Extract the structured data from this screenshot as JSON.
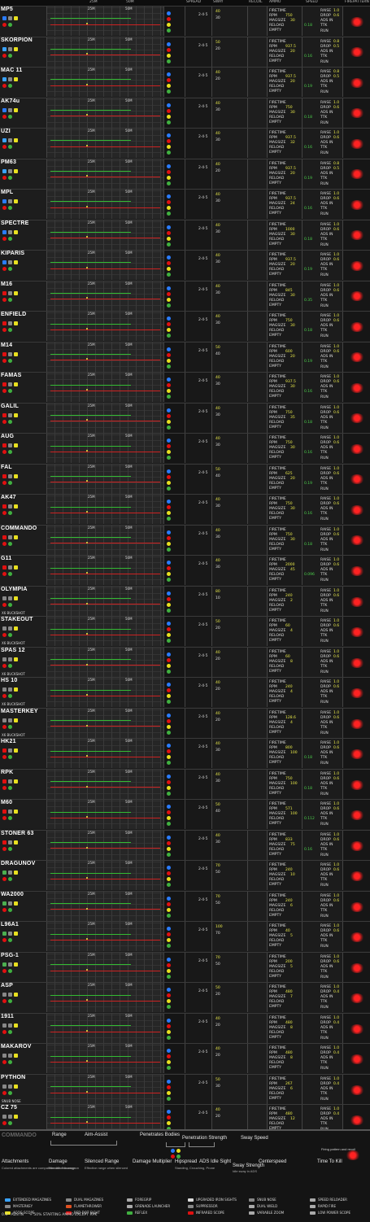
{
  "headers": {
    "damage": "DAMAGE",
    "spread": "SPREAD",
    "sway": "SWAY",
    "recoil": "RECOIL",
    "ammo": "AMMO",
    "speed": "SPEED",
    "firepattern": "FIREPATTERN",
    "r25": "25M",
    "r50": "50M",
    "r75": "75M",
    "firetime": "FIRETIME",
    "rpm": "RPM",
    "magsize": "MAGSIZE",
    "reload": "RELOAD",
    "empty": "EMPTY",
    "raise": "RAISE",
    "drop": "DROP",
    "ads_in": "ADS IN",
    "ttk": "TTK",
    "run": "RUN"
  },
  "weapons": [
    {
      "name": "MP5",
      "sub": "",
      "accent": "#2a7cff",
      "dmg1": "40",
      "dmg2": "30",
      "mag": "30",
      "rpm": "750",
      "ttk": "0.18",
      "raise": "1.0",
      "drop": "0.6"
    },
    {
      "name": "SKORPION",
      "sub": "",
      "accent": "#3aa3ff",
      "dmg1": "50",
      "dmg2": "20",
      "mag": "20",
      "rpm": "937.5",
      "ttk": "0.16",
      "raise": "0.8",
      "drop": "0.5"
    },
    {
      "name": "MAC 11",
      "sub": "",
      "accent": "#3aa3ff",
      "dmg1": "40",
      "dmg2": "20",
      "mag": "20",
      "rpm": "937.5",
      "ttk": "0.19",
      "raise": "0.8",
      "drop": "0.5"
    },
    {
      "name": "AK74u",
      "sub": "",
      "accent": "#2a7cff",
      "dmg1": "40",
      "dmg2": "30",
      "mag": "30",
      "rpm": "750",
      "ttk": "0.18",
      "raise": "1.0",
      "drop": "0.6"
    },
    {
      "name": "UZI",
      "sub": "",
      "accent": "#3aa3ff",
      "dmg1": "40",
      "dmg2": "30",
      "mag": "32",
      "rpm": "937.5",
      "ttk": "0.16",
      "raise": "1.0",
      "drop": "0.6"
    },
    {
      "name": "PM63",
      "sub": "",
      "accent": "#3aa3ff",
      "dmg1": "40",
      "dmg2": "20",
      "mag": "20",
      "rpm": "937.5",
      "ttk": "0.19",
      "raise": "0.8",
      "drop": "0.5"
    },
    {
      "name": "MPL",
      "sub": "",
      "accent": "#2a7cff",
      "dmg1": "40",
      "dmg2": "30",
      "mag": "24",
      "rpm": "937.5",
      "ttk": "0.16",
      "raise": "1.0",
      "drop": "0.6"
    },
    {
      "name": "SPECTRE",
      "sub": "",
      "accent": "#2a7cff",
      "dmg1": "40",
      "dmg2": "30",
      "mag": "30",
      "rpm": "1000",
      "ttk": "0.18",
      "raise": "1.0",
      "drop": "0.6"
    },
    {
      "name": "KIPARIS",
      "sub": "",
      "accent": "#2a7cff",
      "dmg1": "40",
      "dmg2": "30",
      "mag": "20",
      "rpm": "937.5",
      "ttk": "0.19",
      "raise": "1.0",
      "drop": "0.6"
    },
    {
      "name": "M16",
      "sub": "",
      "accent": "#e01010",
      "dmg1": "40",
      "dmg2": "30",
      "mag": "30",
      "rpm": "845",
      "ttk": "0.35",
      "raise": "1.0",
      "drop": "0.6"
    },
    {
      "name": "ENFIELD",
      "sub": "",
      "accent": "#e01010",
      "dmg1": "40",
      "dmg2": "30",
      "mag": "30",
      "rpm": "750",
      "ttk": "0.18",
      "raise": "1.0",
      "drop": "0.6"
    },
    {
      "name": "M14",
      "sub": "",
      "accent": "#e01010",
      "dmg1": "50",
      "dmg2": "40",
      "mag": "20",
      "rpm": "600",
      "ttk": "0.19",
      "raise": "1.0",
      "drop": "0.6"
    },
    {
      "name": "FAMAS",
      "sub": "",
      "accent": "#e01010",
      "dmg1": "40",
      "dmg2": "30",
      "mag": "30",
      "rpm": "937.5",
      "ttk": "0.16",
      "raise": "1.0",
      "drop": "0.6"
    },
    {
      "name": "GALIL",
      "sub": "",
      "accent": "#e01010",
      "dmg1": "40",
      "dmg2": "30",
      "mag": "35",
      "rpm": "750",
      "ttk": "0.18",
      "raise": "1.0",
      "drop": "0.6"
    },
    {
      "name": "AUG",
      "sub": "",
      "accent": "#e01010",
      "dmg1": "40",
      "dmg2": "30",
      "mag": "30",
      "rpm": "750",
      "ttk": "0.16",
      "raise": "1.0",
      "drop": "0.6"
    },
    {
      "name": "FAL",
      "sub": "",
      "accent": "#e01010",
      "dmg1": "50",
      "dmg2": "40",
      "mag": "20",
      "rpm": "625",
      "ttk": "0.19",
      "raise": "1.0",
      "drop": "0.6"
    },
    {
      "name": "AK47",
      "sub": "",
      "accent": "#e01010",
      "dmg1": "40",
      "dmg2": "30",
      "mag": "30",
      "rpm": "750",
      "ttk": "0.16",
      "raise": "1.0",
      "drop": "0.6"
    },
    {
      "name": "COMMANDO",
      "sub": "",
      "accent": "#e01010",
      "dmg1": "40",
      "dmg2": "30",
      "mag": "30",
      "rpm": "750",
      "ttk": "0.18",
      "raise": "1.0",
      "drop": "0.6"
    },
    {
      "name": "G11",
      "sub": "",
      "accent": "#e01010",
      "dmg1": "40",
      "dmg2": "30",
      "mag": "45",
      "rpm": "2000",
      "ttk": "0.096",
      "raise": "1.0",
      "drop": "0.6"
    },
    {
      "name": "OLYMPIA",
      "sub": "X6 BUCKSHOT",
      "accent": "#888888",
      "dmg1": "80",
      "dmg2": "10",
      "mag": "2",
      "rpm": "240",
      "ttk": "",
      "raise": "1.0",
      "drop": "0.6"
    },
    {
      "name": "STAKEOUT",
      "sub": "X6 BUCKSHOT",
      "accent": "#888888",
      "dmg1": "50",
      "dmg2": "20",
      "mag": "4",
      "rpm": "60",
      "ttk": "",
      "raise": "1.0",
      "drop": "0.6"
    },
    {
      "name": "SPAS 12",
      "sub": "X6 BUCKSHOT",
      "accent": "#888888",
      "dmg1": "40",
      "dmg2": "20",
      "mag": "8",
      "rpm": "60",
      "ttk": "",
      "raise": "1.0",
      "drop": "0.6"
    },
    {
      "name": "HS 10",
      "sub": "X6 BUCKSHOT",
      "accent": "#888888",
      "dmg1": "40",
      "dmg2": "20",
      "mag": "4",
      "rpm": "240",
      "ttk": "",
      "raise": "1.0",
      "drop": "0.6"
    },
    {
      "name": "MASTERKEY",
      "sub": "X6 BUCKSHOT",
      "accent": "#888888",
      "dmg1": "40",
      "dmg2": "20",
      "mag": "4",
      "rpm": "128.6",
      "ttk": "",
      "raise": "1.0",
      "drop": "0.6"
    },
    {
      "name": "HK21",
      "sub": "",
      "accent": "#e01010",
      "dmg1": "40",
      "dmg2": "30",
      "mag": "100",
      "rpm": "800",
      "ttk": "0.18",
      "raise": "1.0",
      "drop": "0.6"
    },
    {
      "name": "RPK",
      "sub": "",
      "accent": "#e01010",
      "dmg1": "40",
      "dmg2": "30",
      "mag": "100",
      "rpm": "750",
      "ttk": "0.18",
      "raise": "1.0",
      "drop": "0.6"
    },
    {
      "name": "M60",
      "sub": "",
      "accent": "#e01010",
      "dmg1": "50",
      "dmg2": "40",
      "mag": "100",
      "rpm": "571",
      "ttk": "0.112",
      "raise": "1.0",
      "drop": "0.6"
    },
    {
      "name": "STONER 63",
      "sub": "",
      "accent": "#e01010",
      "dmg1": "40",
      "dmg2": "30",
      "mag": "75",
      "rpm": "833",
      "ttk": "0.16",
      "raise": "1.0",
      "drop": "0.6"
    },
    {
      "name": "DRAGUNOV",
      "sub": "",
      "accent": "#4caf50",
      "dmg1": "70",
      "dmg2": "50",
      "mag": "10",
      "rpm": "240",
      "ttk": "",
      "raise": "1.0",
      "drop": "0.6"
    },
    {
      "name": "WA2000",
      "sub": "",
      "accent": "#4caf50",
      "dmg1": "70",
      "dmg2": "50",
      "mag": "6",
      "rpm": "240",
      "ttk": "",
      "raise": "1.0",
      "drop": "0.6"
    },
    {
      "name": "L96A1",
      "sub": "",
      "accent": "#4caf50",
      "dmg1": "100",
      "dmg2": "70",
      "mag": "5",
      "rpm": "40",
      "ttk": "",
      "raise": "1.0",
      "drop": "0.6"
    },
    {
      "name": "PSG-1",
      "sub": "",
      "accent": "#4caf50",
      "dmg1": "70",
      "dmg2": "50",
      "mag": "5",
      "rpm": "200",
      "ttk": "",
      "raise": "1.0",
      "drop": "0.6"
    },
    {
      "name": "ASP",
      "sub": "",
      "accent": "#888888",
      "dmg1": "50",
      "dmg2": "20",
      "mag": "7",
      "rpm": "480",
      "ttk": "",
      "raise": "1.0",
      "drop": "0.4"
    },
    {
      "name": "1911",
      "sub": "",
      "accent": "#888888",
      "dmg1": "40",
      "dmg2": "20",
      "mag": "8",
      "rpm": "480",
      "ttk": "",
      "raise": "1.0",
      "drop": "0.4"
    },
    {
      "name": "MAKAROV",
      "sub": "",
      "accent": "#888888",
      "dmg1": "40",
      "dmg2": "20",
      "mag": "8",
      "rpm": "480",
      "ttk": "",
      "raise": "1.0",
      "drop": "0.4"
    },
    {
      "name": "PYTHON",
      "sub": "SNUB NOSE",
      "accent": "#888888",
      "dmg1": "50",
      "dmg2": "30",
      "mag": "6",
      "rpm": "267",
      "ttk": "",
      "raise": "1.0",
      "drop": "0.4"
    },
    {
      "name": "CZ 75",
      "sub": "FULL AUTO",
      "accent": "#888888",
      "dmg1": "40",
      "dmg2": "20",
      "mag": "12",
      "rpm": "480",
      "ttk": "",
      "raise": "1.0",
      "drop": "0.4"
    }
  ],
  "legend": {
    "example_name": "COMMANDO",
    "range": "Range",
    "aim_assist": "Aim-Assist",
    "penetrates": "Penetrates Bodies",
    "pen_strength": "Penetration Strength",
    "sway_speed": "Sway Speed",
    "attachments": "Attachments",
    "damage": "Damage",
    "silenced_range": "Silenced Range",
    "damage_mult": "Damage Multiplier",
    "hipspread": "Hipspread",
    "ads_idle": "ADS Idle Sight",
    "sway_strength": "Sway Strength",
    "centerspeed": "Centerspeed",
    "ttk": "Time To Kill",
    "att_note": "Colored attachments are compatible with this weapon",
    "dmg_note": "Headshot damage",
    "silenced_note": "Effective range when silenced",
    "hip_note": "Standing, Crouching, Prone",
    "sway_note": "Idle sway in ADS",
    "firepattern_note": "Firing pattern and recoil"
  },
  "attachments": [
    {
      "label": "EXTENDED MAGAZINES",
      "color": "#3aa3ff"
    },
    {
      "label": "DUAL MAGAZINES",
      "color": "#888888"
    },
    {
      "label": "FOREGRIP",
      "color": "#aaaaaa"
    },
    {
      "label": "UPGRADED IRON SIGHTS",
      "color": "#dddddd"
    },
    {
      "label": "SNUB NOSE",
      "color": "#888888"
    },
    {
      "label": "SPEED RELOADER",
      "color": "#aaaaaa"
    },
    {
      "label": "MASTERKEY",
      "color": "#888888"
    },
    {
      "label": "FLAMETHROWER",
      "color": "#e05020"
    },
    {
      "label": "GRENADE LAUNCHER",
      "color": "#aaaaaa"
    },
    {
      "label": "SUPPRESSOR",
      "color": "#888888"
    },
    {
      "label": "DUAL WIELD",
      "color": "#aaaaaa"
    },
    {
      "label": "RAPID FIRE",
      "color": "#aaaaaa"
    },
    {
      "label": "ACOG SCOPE",
      "color": "#e8e020"
    },
    {
      "label": "RED DOT SIGHT",
      "color": "#e01010"
    },
    {
      "label": "REFLEX",
      "color": "#40b040"
    },
    {
      "label": "INFRARED SCOPE",
      "color": "#e01010"
    },
    {
      "label": "VARIABLE ZOOM",
      "color": "#aaaaaa"
    },
    {
      "label": "LOW POWER SCOPE",
      "color": "#aaaaaa"
    }
  ],
  "footer": {
    "scale": "0.4 · ADS IN",
    "note": "+ 50% STARTING AMMO EXCEPT RPK"
  }
}
